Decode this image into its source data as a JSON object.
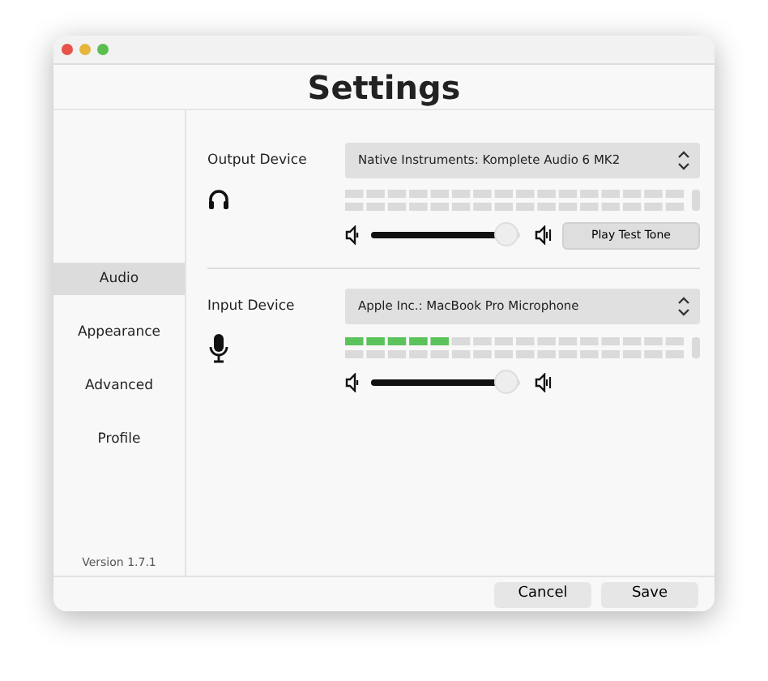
{
  "window": {
    "title": "Settings"
  },
  "sidebar": {
    "items": [
      {
        "label": "Audio",
        "selected": true
      },
      {
        "label": "Appearance",
        "selected": false
      },
      {
        "label": "Advanced",
        "selected": false
      },
      {
        "label": "Profile",
        "selected": false
      }
    ],
    "version": "Version 1.7.1"
  },
  "sections": [
    {
      "label": "Output Device",
      "kind": "output",
      "device": "Native Instruments: Komplete Audio 6 MK2",
      "volume": {
        "level": 0.9
      },
      "button": "Play Test Tone"
    },
    {
      "label": "Input Device",
      "kind": "input",
      "device": "Apple Inc.: MacBook Pro Microphone",
      "meter": {
        "level": 0.3125
      },
      "volume": {
        "level": 0.9
      }
    }
  ],
  "buttons": [
    "Cancel",
    "Save"
  ]
}
